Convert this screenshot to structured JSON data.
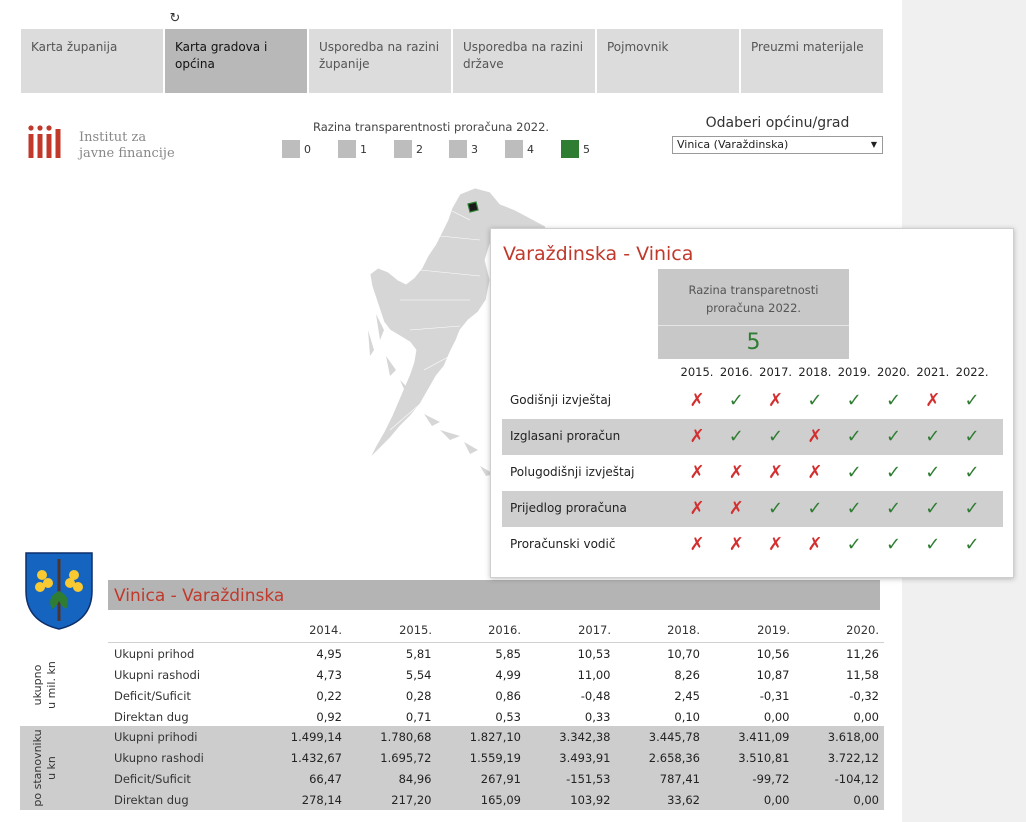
{
  "tabs": [
    {
      "label": "Karta županija",
      "active": false
    },
    {
      "label": "Karta gradova i općina",
      "active": true
    },
    {
      "label": "Usporedba na razini županije",
      "active": false
    },
    {
      "label": "Usporedba na razini države",
      "active": false
    },
    {
      "label": "Pojmovnik",
      "active": false
    },
    {
      "label": "Preuzmi materijale",
      "active": false
    }
  ],
  "logo": {
    "line1": "Institut za",
    "line2": "javne financije",
    "color": "#c0392b"
  },
  "legend": {
    "title": "Razina transparentnosti proračuna 2022.",
    "items": [
      {
        "label": "0",
        "color": "#bdbdbd"
      },
      {
        "label": "1",
        "color": "#bdbdbd"
      },
      {
        "label": "2",
        "color": "#bdbdbd"
      },
      {
        "label": "3",
        "color": "#bdbdbd"
      },
      {
        "label": "4",
        "color": "#bdbdbd"
      },
      {
        "label": "5",
        "color": "#2e7d32"
      }
    ]
  },
  "selector": {
    "title": "Odaberi općinu/grad",
    "value": "Vinica (Varaždinska)"
  },
  "tooltip": {
    "title": "Varaždinska - Vinica",
    "box_label_line1": "Razina transparetnosti",
    "box_label_line2": "proračuna  2022.",
    "value": "5",
    "years": [
      "2015.",
      "2016.",
      "2017.",
      "2018.",
      "2019.",
      "2020.",
      "2021.",
      "2022."
    ],
    "rows": [
      {
        "label": "Godišnji izvještaj",
        "marks": [
          "no",
          "ok",
          "no",
          "ok",
          "ok",
          "ok",
          "no",
          "ok"
        ]
      },
      {
        "label": "Izglasani proračun",
        "marks": [
          "no",
          "ok",
          "ok",
          "no",
          "ok",
          "ok",
          "ok",
          "ok"
        ]
      },
      {
        "label": "Polugodišnji izvještaj",
        "marks": [
          "no",
          "no",
          "no",
          "no",
          "ok",
          "ok",
          "ok",
          "ok"
        ]
      },
      {
        "label": "Prijedlog proračuna",
        "marks": [
          "no",
          "no",
          "ok",
          "ok",
          "ok",
          "ok",
          "ok",
          "ok"
        ]
      },
      {
        "label": "Proračunski vodič",
        "marks": [
          "no",
          "no",
          "no",
          "no",
          "ok",
          "ok",
          "ok",
          "ok"
        ]
      }
    ],
    "ok_symbol": "✓",
    "no_symbol": "✗"
  },
  "finance": {
    "title": "Vinica - Varaždinska",
    "years": [
      "2014.",
      "2015.",
      "2016.",
      "2017.",
      "2018.",
      "2019.",
      "2020."
    ],
    "groups": [
      {
        "side_line1": "ukupno",
        "side_line2": "u mil. kn",
        "rows": [
          {
            "label": "Ukupni prihod",
            "values": [
              "4,95",
              "5,81",
              "5,85",
              "10,53",
              "10,70",
              "10,56",
              "11,26"
            ]
          },
          {
            "label": "Ukupni rashodi",
            "values": [
              "4,73",
              "5,54",
              "4,99",
              "11,00",
              "8,26",
              "10,87",
              "11,58"
            ]
          },
          {
            "label": "Deficit/Suficit",
            "values": [
              "0,22",
              "0,28",
              "0,86",
              "-0,48",
              "2,45",
              "-0,31",
              "-0,32"
            ]
          },
          {
            "label": "Direktan dug",
            "values": [
              "0,92",
              "0,71",
              "0,53",
              "0,33",
              "0,10",
              "0,00",
              "0,00"
            ]
          }
        ]
      },
      {
        "side_line1": "po stanovniku",
        "side_line2": "u kn",
        "rows": [
          {
            "label": "Ukupni prihodi",
            "values": [
              "1.499,14",
              "1.780,68",
              "1.827,10",
              "3.342,38",
              "3.445,78",
              "3.411,09",
              "3.618,00"
            ]
          },
          {
            "label": "Ukupno rashodi",
            "values": [
              "1.432,67",
              "1.695,72",
              "1.559,19",
              "3.493,91",
              "2.658,36",
              "3.510,81",
              "3.722,12"
            ]
          },
          {
            "label": "Deficit/Suficit",
            "values": [
              "66,47",
              "84,96",
              "267,91",
              "-151,53",
              "787,41",
              "-99,72",
              "-104,12"
            ]
          },
          {
            "label": "Direktan dug",
            "values": [
              "278,14",
              "217,20",
              "165,09",
              "103,92",
              "33,62",
              "0,00",
              "0,00"
            ]
          }
        ]
      }
    ]
  }
}
